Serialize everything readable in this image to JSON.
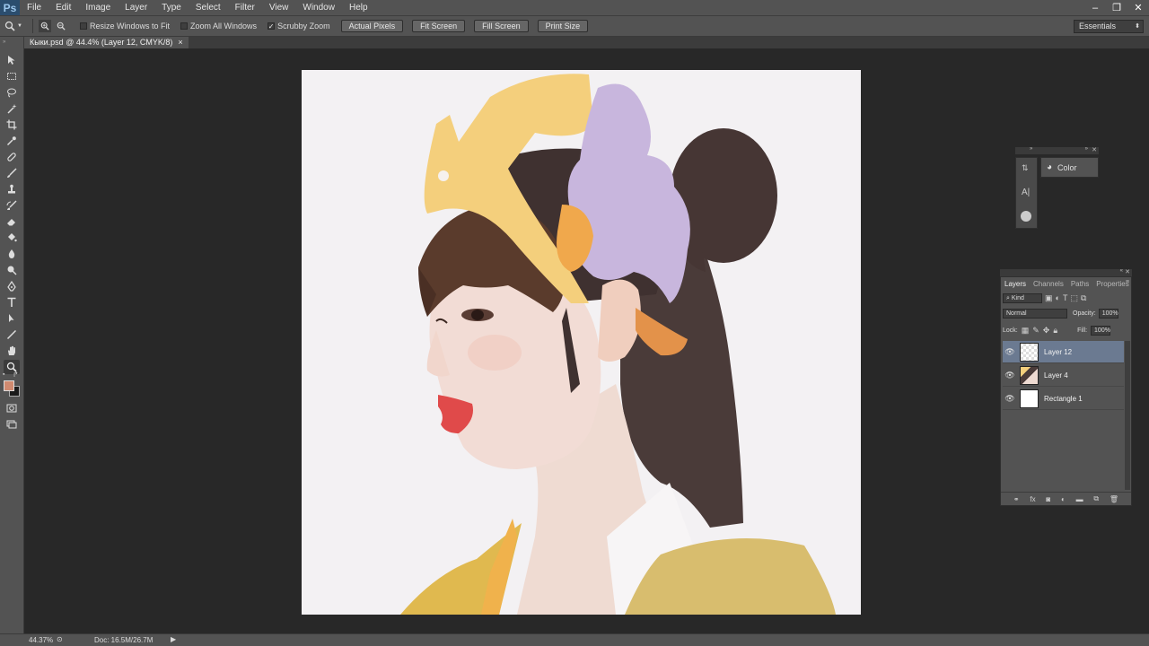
{
  "app": {
    "logo": "Ps"
  },
  "menu": [
    "File",
    "Edit",
    "Image",
    "Layer",
    "Type",
    "Select",
    "Filter",
    "View",
    "Window",
    "Help"
  ],
  "options": {
    "resize_windows": "Resize Windows to Fit",
    "zoom_all": "Zoom All Windows",
    "scrubby_zoom": "Scrubby Zoom",
    "scrubby_checked": true,
    "buttons": [
      "Actual Pixels",
      "Fit Screen",
      "Fill Screen",
      "Print Size"
    ],
    "workspace": "Essentials"
  },
  "document": {
    "tab_title": "Кыки.psd @ 44.4% (Layer 12, CMYK/8)",
    "tab_close": "×"
  },
  "status": {
    "zoom": "44.37%",
    "doc_info": "Doc: 16.5M/26.7M"
  },
  "mini_panel": {
    "color_label": "Color"
  },
  "layers": {
    "tabs": [
      "Layers",
      "Channels",
      "Paths",
      "Properties"
    ],
    "filter_kind": "Kind",
    "blend_mode": "Normal",
    "opacity_label": "Opacity:",
    "opacity_value": "100%",
    "lock_label": "Lock:",
    "fill_label": "Fill:",
    "fill_value": "100%",
    "items": [
      {
        "name": "Layer 12",
        "active": true
      },
      {
        "name": "Layer 4",
        "active": false
      },
      {
        "name": "Rectangle 1",
        "active": false
      }
    ]
  },
  "colors": {
    "foreground": "#d08a70",
    "background": "#1a1a1a",
    "ui_panel": "#535353",
    "active_layer": "#6b7a91"
  }
}
